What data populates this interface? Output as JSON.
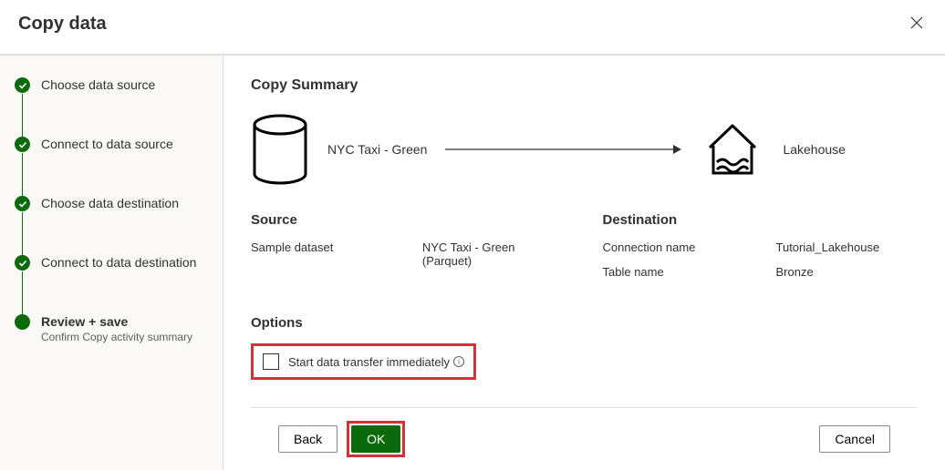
{
  "header": {
    "title": "Copy data"
  },
  "sidebar": {
    "steps": [
      {
        "label": "Choose data source",
        "done": true
      },
      {
        "label": "Connect to data source",
        "done": true
      },
      {
        "label": "Choose data destination",
        "done": true
      },
      {
        "label": "Connect to data destination",
        "done": true
      },
      {
        "label": "Review + save",
        "sub": "Confirm Copy activity summary",
        "current": true
      }
    ]
  },
  "main": {
    "summary_title": "Copy Summary",
    "source_name": "NYC Taxi - Green",
    "dest_name": "Lakehouse",
    "source_section": "Source",
    "dest_section": "Destination",
    "source_details": [
      {
        "label": "Sample dataset",
        "value": "NYC Taxi - Green (Parquet)"
      }
    ],
    "dest_details": [
      {
        "label": "Connection name",
        "value": "Tutorial_Lakehouse"
      },
      {
        "label": "Table name",
        "value": "Bronze"
      }
    ],
    "options_title": "Options",
    "start_immediately": "Start data transfer immediately"
  },
  "footer": {
    "back": "Back",
    "ok": "OK",
    "cancel": "Cancel"
  },
  "colors": {
    "accent": "#0b6a0b",
    "highlight": "#d13438"
  }
}
